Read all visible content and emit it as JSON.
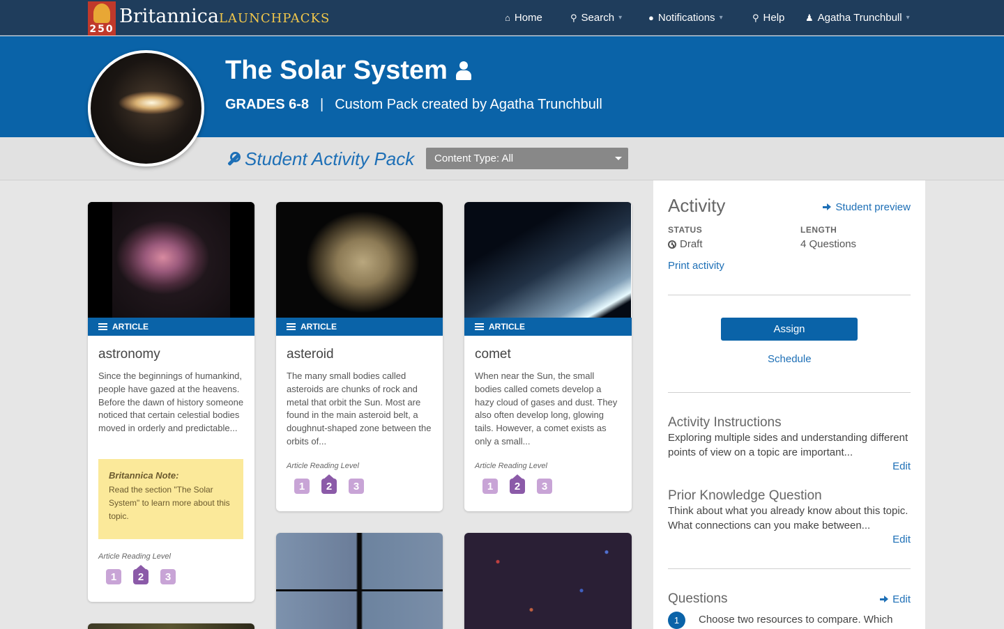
{
  "nav": {
    "logo_badge": "250",
    "logo_main": "Britannica",
    "logo_sub": "LAUNCHPACKS",
    "home": "Home",
    "search": "Search",
    "notifications": "Notifications",
    "help": "Help",
    "user": "Agatha Trunchbull"
  },
  "hero": {
    "title": "The Solar System",
    "grades": "GRADES 6-8",
    "separator": "|",
    "subtitle": "Custom Pack created by Agatha Trunchbull"
  },
  "toolbar": {
    "pack_title": "Student Activity Pack",
    "content_type": "Content Type: All"
  },
  "cards": [
    {
      "tag": "ARTICLE",
      "title": "astronomy",
      "desc": "Since the beginnings of humankind, people have gazed at the heavens. Before the dawn of history someone noticed that certain celestial bodies moved in orderly and predictable...",
      "note_title": "Britannica Note:",
      "note_text": "Read the section \"The Solar System\" to learn more about this topic.",
      "reading_label": "Article Reading Level",
      "levels": [
        "1",
        "2",
        "3"
      ],
      "active_level": 2
    },
    {
      "tag": "ARTICLE",
      "title": "asteroid",
      "desc": "The many small bodies called asteroids are chunks of rock and metal that orbit the Sun. Most are found in the main asteroid belt, a doughnut-shaped zone between the orbits of...",
      "reading_label": "Article Reading Level",
      "levels": [
        "1",
        "2",
        "3"
      ],
      "active_level": 2
    },
    {
      "tag": "ARTICLE",
      "title": "comet",
      "desc": "When near the Sun, the small bodies called comets develop a hazy cloud of gases and dust. They also often develop long, glowing tails. However, a comet exists as only a small...",
      "reading_label": "Article Reading Level",
      "levels": [
        "1",
        "2",
        "3"
      ],
      "active_level": 2
    }
  ],
  "sidebar": {
    "heading": "Activity",
    "student_preview": "Student preview",
    "status_label": "STATUS",
    "status_value": "Draft",
    "length_label": "LENGTH",
    "length_value": "4 Questions",
    "print": "Print activity",
    "assign": "Assign",
    "schedule": "Schedule",
    "instructions_title": "Activity Instructions",
    "instructions_text": "Exploring multiple sides and understanding different points of view on a topic are important...",
    "prior_title": "Prior Knowledge Question",
    "prior_text": "Think about what you already know about this topic. What connections can you make between...",
    "edit": "Edit",
    "questions_title": "Questions",
    "q1_num": "1",
    "q1_text": "Choose two resources to compare. Which"
  },
  "colors": {
    "nav_bg": "#1f3d5c",
    "hero_bg": "#0a63a8",
    "link": "#1d6fb6",
    "level_active": "#8b5aa8",
    "level_inactive": "#c8a4d6",
    "note_bg": "#fbe99a"
  },
  "icons": [
    "home-icon",
    "search-icon",
    "comment-icon",
    "lightbulb-icon",
    "user-icon",
    "person-icon",
    "wrench-icon",
    "list-icon",
    "clock-icon",
    "arrow-right-icon"
  ]
}
